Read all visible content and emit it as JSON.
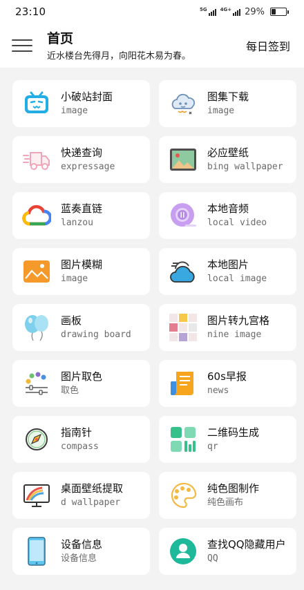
{
  "status_bar": {
    "time": "23:10",
    "signal_1": "5G",
    "signal_2": "4G+",
    "battery_percent": "29%",
    "battery_level": 0.29
  },
  "header": {
    "title": "首页",
    "subtitle": "近水楼台先得月，向阳花木易为春。",
    "checkin_label": "每日签到"
  },
  "cards": [
    {
      "title": "小破站封面",
      "subtitle": "image",
      "icon": "bilibili-tv-icon",
      "color": "#23ade5"
    },
    {
      "title": "图集下载",
      "subtitle": "image",
      "icon": "cloud-doodle-icon",
      "color": "#6b8fb8"
    },
    {
      "title": "快递查询",
      "subtitle": "expressage",
      "icon": "delivery-truck-icon",
      "color": "#f2a5b8"
    },
    {
      "title": "必应壁纸",
      "subtitle": "bing wallpaper",
      "icon": "wallpaper-picture-icon",
      "color": "#8fc9a0"
    },
    {
      "title": "蓝奏直链",
      "subtitle": "lanzou",
      "icon": "google-cloud-icon",
      "color": "#4285f4"
    },
    {
      "title": "本地音频",
      "subtitle": "local video",
      "icon": "audio-disc-icon",
      "color": "#c79ef0"
    },
    {
      "title": "图片模糊",
      "subtitle": "image",
      "icon": "landscape-image-icon",
      "color": "#f59a2a"
    },
    {
      "title": "本地图片",
      "subtitle": "local image",
      "icon": "weather-cloud-icon",
      "color": "#39a8e0"
    },
    {
      "title": "画板",
      "subtitle": "drawing board",
      "icon": "balloons-icon",
      "color": "#7fd0ec"
    },
    {
      "title": "图片转九宫格",
      "subtitle": "nine image",
      "icon": "nine-grid-icon",
      "color": "#e57d8f"
    },
    {
      "title": "图片取色",
      "subtitle": "取色",
      "icon": "color-picker-icon",
      "color": "#8a6cc9"
    },
    {
      "title": "60s早报",
      "subtitle": "news",
      "icon": "newspaper-icon",
      "color": "#f7a51c"
    },
    {
      "title": "指南针",
      "subtitle": "compass",
      "icon": "compass-icon",
      "color": "#f2b233"
    },
    {
      "title": "二维码生成",
      "subtitle": "qr",
      "icon": "qr-code-icon",
      "color": "#37c18a"
    },
    {
      "title": "桌面壁纸提取",
      "subtitle": "d wallpaper",
      "icon": "desktop-monitor-icon",
      "color": "#e8524a"
    },
    {
      "title": "纯色图制作",
      "subtitle": "纯色画布",
      "icon": "paint-palette-icon",
      "color": "#f4b942"
    },
    {
      "title": "设备信息",
      "subtitle": "设备信息",
      "icon": "mobile-phone-icon",
      "color": "#5ec5ef"
    },
    {
      "title": "查找QQ隐藏用户",
      "subtitle": "QQ",
      "icon": "user-avatar-icon",
      "color": "#1eb89a"
    }
  ]
}
